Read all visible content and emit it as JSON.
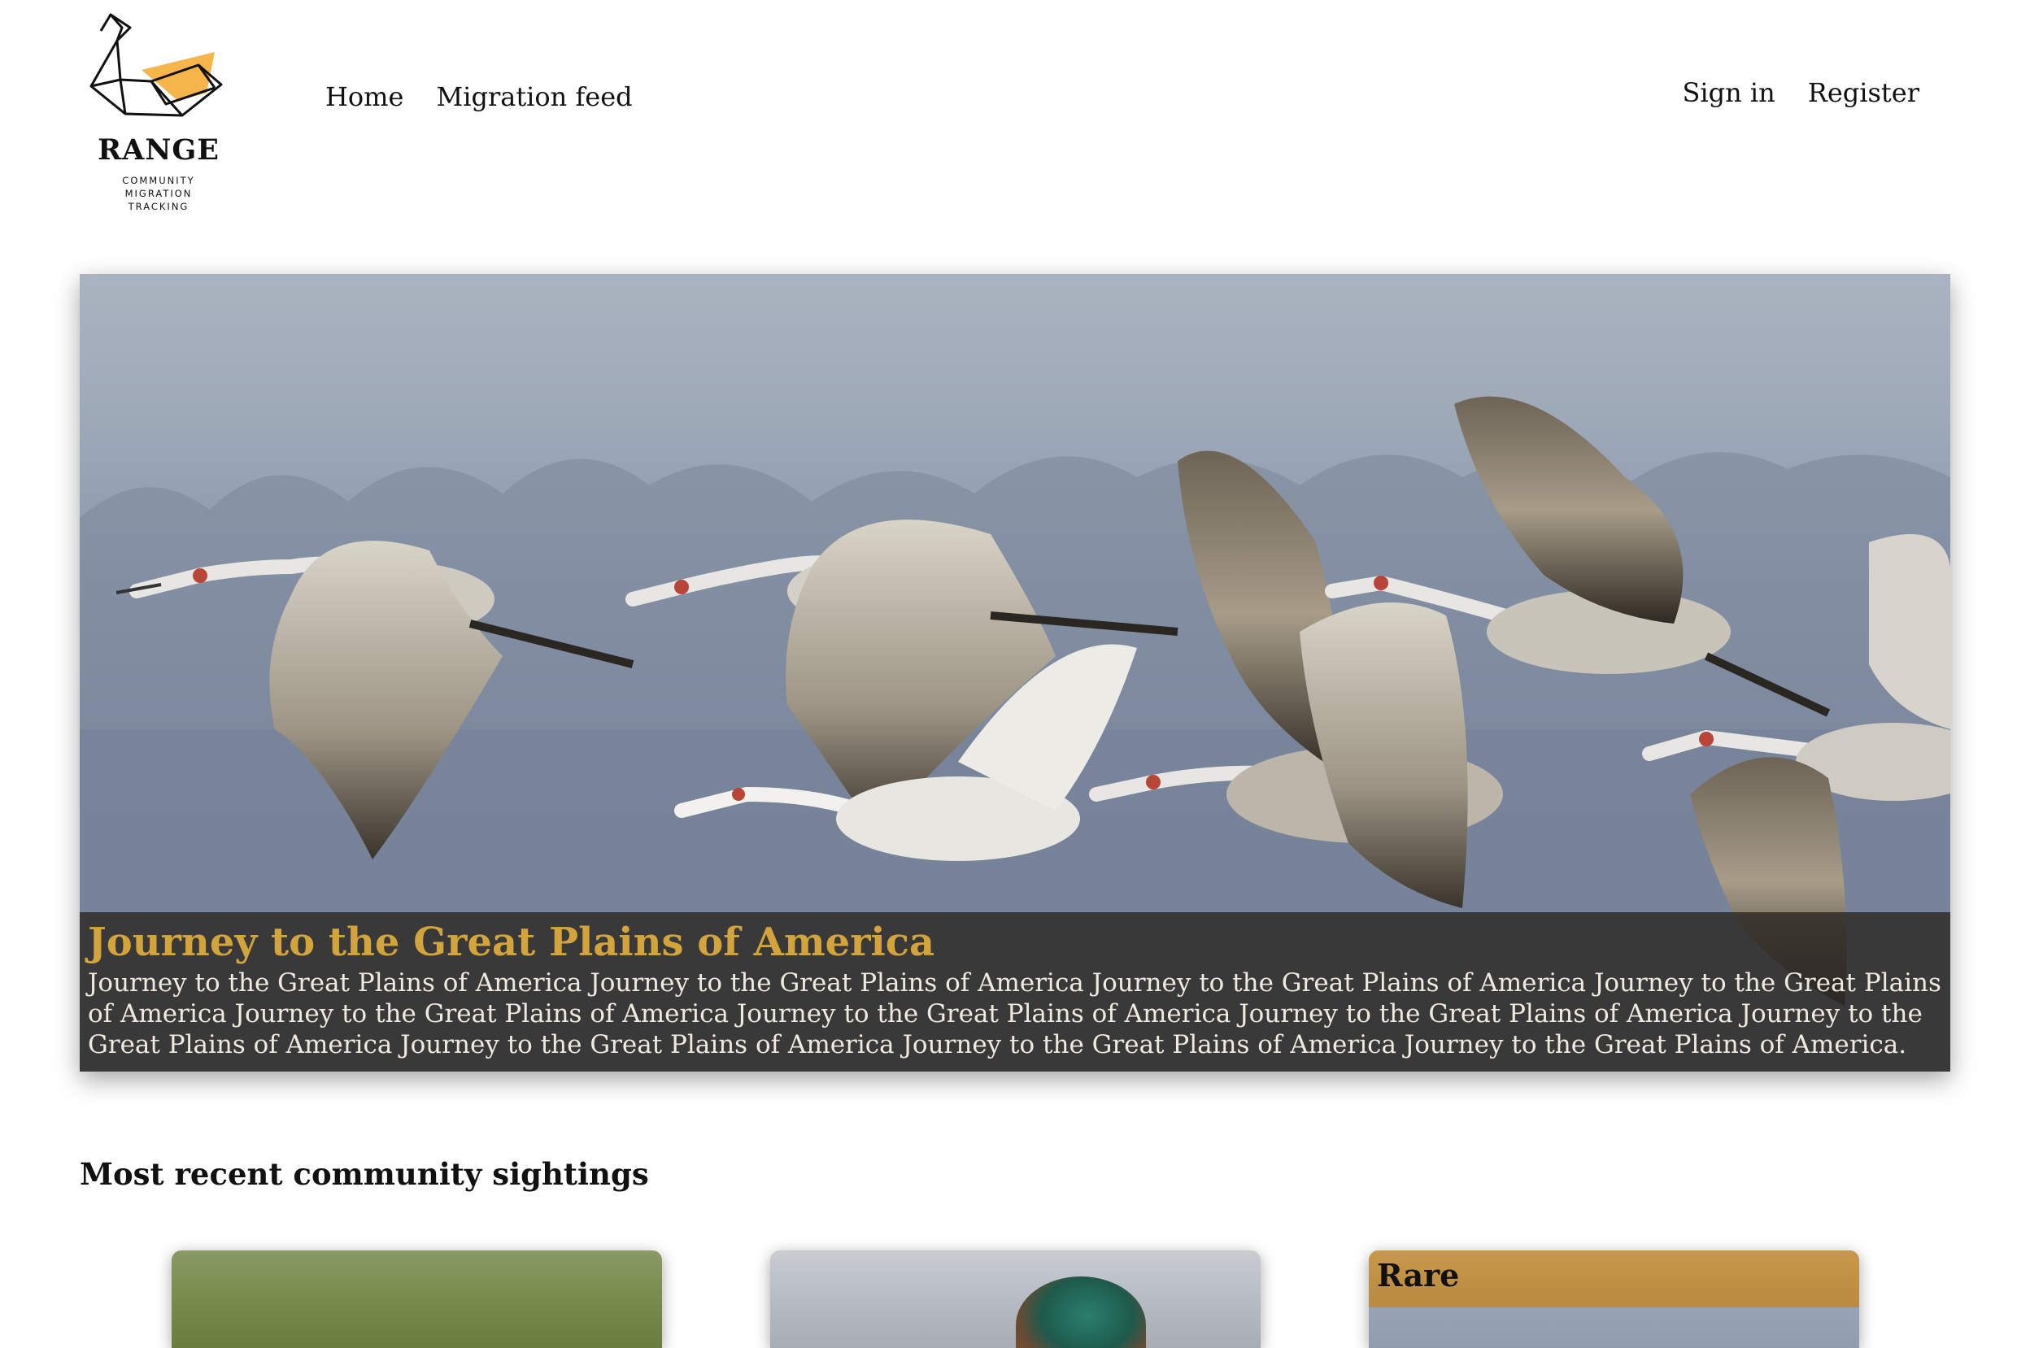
{
  "brand": {
    "name": "RANGE",
    "tagline_lines": [
      "COMMUNITY",
      "MIGRATION",
      "TRACKING"
    ],
    "accent_color": "#f5b54a"
  },
  "nav": {
    "left": [
      "Home",
      "Migration feed"
    ],
    "right": [
      "Sign in",
      "Register"
    ]
  },
  "hero": {
    "title": "Journey to the Great Plains of America",
    "text": "Journey to the Great Plains of America Journey to the Great Plains of America Journey to the Great Plains of America Journey to the Great Plains of America Journey to the Great Plains of America Journey to the Great Plains of America Journey to the Great Plains of America Journey to the Great Plains of America Journey to the Great Plains of America Journey to the Great Plains of America Journey to the Great Plains of America.",
    "title_color": "#d4a43c"
  },
  "sightings": {
    "heading": "Most recent community sightings",
    "cards": [
      {
        "badge": ""
      },
      {
        "badge": ""
      },
      {
        "badge": "Rare",
        "badge_color": "#c8984a"
      }
    ]
  }
}
